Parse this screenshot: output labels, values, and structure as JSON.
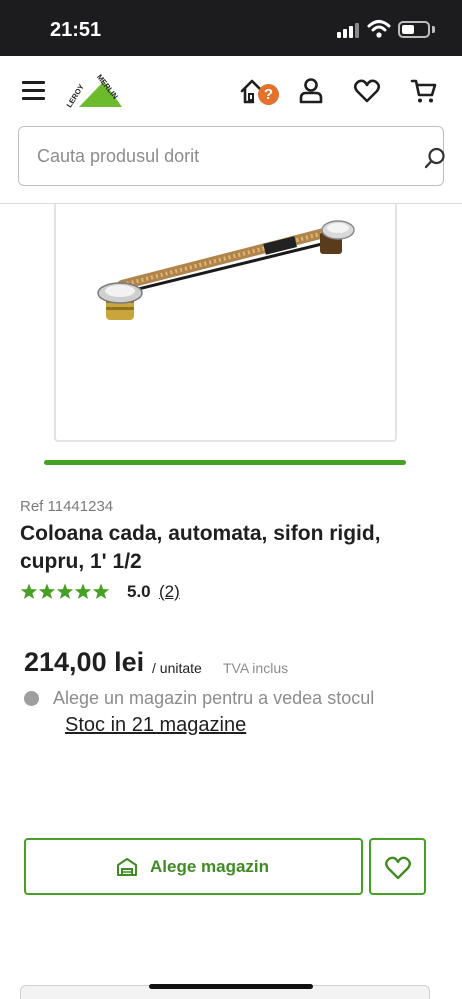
{
  "status_bar": {
    "time": "21:51"
  },
  "header": {
    "logo_text_top": "LEROY",
    "logo_text_bottom": "MERLIN",
    "help_badge": "?",
    "icons": [
      "menu-icon",
      "house-help-icon",
      "user-icon",
      "heart-icon",
      "cart-icon"
    ]
  },
  "search": {
    "placeholder": "Cauta produsul dorit",
    "value": ""
  },
  "product": {
    "ref_label": "Ref 11441234",
    "title": "Coloana cada, automata, sifon rigid, cupru, 1' 1/2",
    "rating_value": "5.0",
    "rating_count": "(2)",
    "rating_stars": 5,
    "price": "214,00 lei",
    "unit": "/ unitate",
    "vat": "TVA inclus",
    "stock_message": "Alege un magazin pentru a vedea stocul",
    "stock_link": "Stoc in 21 magazine"
  },
  "actions": {
    "choose_store_label": "Alege magazin"
  },
  "colors": {
    "brand_green": "#46a024",
    "status_bar_bg": "#1c1c1e",
    "help_badge": "#e4722c",
    "star": "#46a024"
  }
}
